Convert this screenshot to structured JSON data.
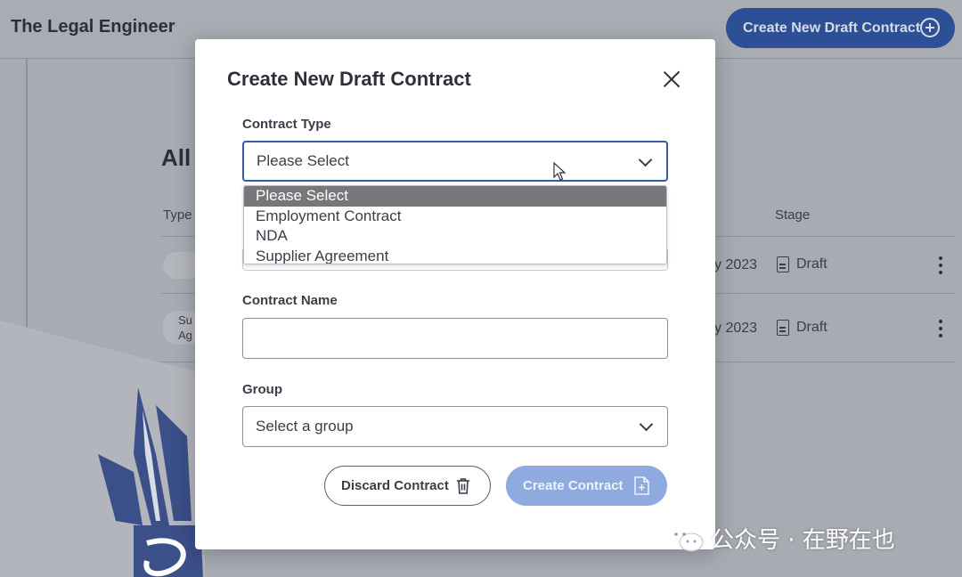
{
  "app": {
    "brand": "The Legal Engineer",
    "create_button_label": "Create New Draft Contract"
  },
  "background": {
    "heading": "All",
    "columns": {
      "type": "Type",
      "stage": "Stage"
    },
    "rows": [
      {
        "type_partial": "",
        "date_partial": "y 2023",
        "stage": "Draft"
      },
      {
        "type_partial": "Su Ag",
        "date_partial": "y 2023",
        "stage": "Draft"
      }
    ]
  },
  "modal": {
    "title": "Create New Draft Contract",
    "fields": {
      "contract_type": {
        "label": "Contract Type",
        "selected": "Please Select",
        "options": [
          "Please Select",
          "Employment Contract",
          "NDA",
          "Supplier Agreement"
        ]
      },
      "contract_name": {
        "label": "Contract Name",
        "value": ""
      },
      "group": {
        "label": "Group",
        "selected": "Select a group"
      }
    },
    "buttons": {
      "discard": "Discard Contract",
      "create": "Create Contract"
    }
  },
  "watermark": {
    "text": "公众号 · 在野在也"
  },
  "colors": {
    "primary": "#2d4f96",
    "primary_disabled": "#8eaadf",
    "focus_border": "#3c5aa0",
    "option_selected_bg": "#757779"
  }
}
